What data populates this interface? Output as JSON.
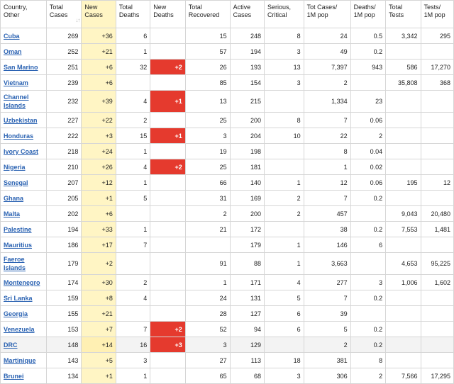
{
  "headers": [
    "Country, Other",
    "Total Cases",
    "New Cases",
    "Total Deaths",
    "New Deaths",
    "Total Recovered",
    "Active Cases",
    "Serious, Critical",
    "Tot Cases/ 1M pop",
    "Deaths/ 1M pop",
    "Total Tests",
    "Tests/ 1M pop"
  ],
  "sort_glyph": "↓↑",
  "rows": [
    {
      "country": "Cuba",
      "total_cases": "269",
      "new_cases": "+36",
      "total_deaths": "6",
      "new_deaths": "",
      "recovered": "15",
      "active": "248",
      "serious": "8",
      "cases_per_m": "24",
      "deaths_per_m": "0.5",
      "tests": "3,342",
      "tests_per_m": "295"
    },
    {
      "country": "Oman",
      "total_cases": "252",
      "new_cases": "+21",
      "total_deaths": "1",
      "new_deaths": "",
      "recovered": "57",
      "active": "194",
      "serious": "3",
      "cases_per_m": "49",
      "deaths_per_m": "0.2",
      "tests": "",
      "tests_per_m": ""
    },
    {
      "country": "San Marino",
      "total_cases": "251",
      "new_cases": "+6",
      "total_deaths": "32",
      "new_deaths": "+2",
      "recovered": "26",
      "active": "193",
      "serious": "13",
      "cases_per_m": "7,397",
      "deaths_per_m": "943",
      "tests": "586",
      "tests_per_m": "17,270"
    },
    {
      "country": "Vietnam",
      "total_cases": "239",
      "new_cases": "+6",
      "total_deaths": "",
      "new_deaths": "",
      "recovered": "85",
      "active": "154",
      "serious": "3",
      "cases_per_m": "2",
      "deaths_per_m": "",
      "tests": "35,808",
      "tests_per_m": "368"
    },
    {
      "country": "Channel Islands",
      "total_cases": "232",
      "new_cases": "+39",
      "total_deaths": "4",
      "new_deaths": "+1",
      "recovered": "13",
      "active": "215",
      "serious": "",
      "cases_per_m": "1,334",
      "deaths_per_m": "23",
      "tests": "",
      "tests_per_m": ""
    },
    {
      "country": "Uzbekistan",
      "total_cases": "227",
      "new_cases": "+22",
      "total_deaths": "2",
      "new_deaths": "",
      "recovered": "25",
      "active": "200",
      "serious": "8",
      "cases_per_m": "7",
      "deaths_per_m": "0.06",
      "tests": "",
      "tests_per_m": ""
    },
    {
      "country": "Honduras",
      "total_cases": "222",
      "new_cases": "+3",
      "total_deaths": "15",
      "new_deaths": "+1",
      "recovered": "3",
      "active": "204",
      "serious": "10",
      "cases_per_m": "22",
      "deaths_per_m": "2",
      "tests": "",
      "tests_per_m": ""
    },
    {
      "country": "Ivory Coast",
      "total_cases": "218",
      "new_cases": "+24",
      "total_deaths": "1",
      "new_deaths": "",
      "recovered": "19",
      "active": "198",
      "serious": "",
      "cases_per_m": "8",
      "deaths_per_m": "0.04",
      "tests": "",
      "tests_per_m": ""
    },
    {
      "country": "Nigeria",
      "total_cases": "210",
      "new_cases": "+26",
      "total_deaths": "4",
      "new_deaths": "+2",
      "recovered": "25",
      "active": "181",
      "serious": "",
      "cases_per_m": "1",
      "deaths_per_m": "0.02",
      "tests": "",
      "tests_per_m": ""
    },
    {
      "country": "Senegal",
      "total_cases": "207",
      "new_cases": "+12",
      "total_deaths": "1",
      "new_deaths": "",
      "recovered": "66",
      "active": "140",
      "serious": "1",
      "cases_per_m": "12",
      "deaths_per_m": "0.06",
      "tests": "195",
      "tests_per_m": "12"
    },
    {
      "country": "Ghana",
      "total_cases": "205",
      "new_cases": "+1",
      "total_deaths": "5",
      "new_deaths": "",
      "recovered": "31",
      "active": "169",
      "serious": "2",
      "cases_per_m": "7",
      "deaths_per_m": "0.2",
      "tests": "",
      "tests_per_m": ""
    },
    {
      "country": "Malta",
      "total_cases": "202",
      "new_cases": "+6",
      "total_deaths": "",
      "new_deaths": "",
      "recovered": "2",
      "active": "200",
      "serious": "2",
      "cases_per_m": "457",
      "deaths_per_m": "",
      "tests": "9,043",
      "tests_per_m": "20,480"
    },
    {
      "country": "Palestine",
      "total_cases": "194",
      "new_cases": "+33",
      "total_deaths": "1",
      "new_deaths": "",
      "recovered": "21",
      "active": "172",
      "serious": "",
      "cases_per_m": "38",
      "deaths_per_m": "0.2",
      "tests": "7,553",
      "tests_per_m": "1,481"
    },
    {
      "country": "Mauritius",
      "total_cases": "186",
      "new_cases": "+17",
      "total_deaths": "7",
      "new_deaths": "",
      "recovered": "",
      "active": "179",
      "serious": "1",
      "cases_per_m": "146",
      "deaths_per_m": "6",
      "tests": "",
      "tests_per_m": ""
    },
    {
      "country": "Faeroe Islands",
      "total_cases": "179",
      "new_cases": "+2",
      "total_deaths": "",
      "new_deaths": "",
      "recovered": "91",
      "active": "88",
      "serious": "1",
      "cases_per_m": "3,663",
      "deaths_per_m": "",
      "tests": "4,653",
      "tests_per_m": "95,225"
    },
    {
      "country": "Montenegro",
      "total_cases": "174",
      "new_cases": "+30",
      "total_deaths": "2",
      "new_deaths": "",
      "recovered": "1",
      "active": "171",
      "serious": "4",
      "cases_per_m": "277",
      "deaths_per_m": "3",
      "tests": "1,006",
      "tests_per_m": "1,602"
    },
    {
      "country": "Sri Lanka",
      "total_cases": "159",
      "new_cases": "+8",
      "total_deaths": "4",
      "new_deaths": "",
      "recovered": "24",
      "active": "131",
      "serious": "5",
      "cases_per_m": "7",
      "deaths_per_m": "0.2",
      "tests": "",
      "tests_per_m": ""
    },
    {
      "country": "Georgia",
      "total_cases": "155",
      "new_cases": "+21",
      "total_deaths": "",
      "new_deaths": "",
      "recovered": "28",
      "active": "127",
      "serious": "6",
      "cases_per_m": "39",
      "deaths_per_m": "",
      "tests": "",
      "tests_per_m": ""
    },
    {
      "country": "Venezuela",
      "total_cases": "153",
      "new_cases": "+7",
      "total_deaths": "7",
      "new_deaths": "+2",
      "recovered": "52",
      "active": "94",
      "serious": "6",
      "cases_per_m": "5",
      "deaths_per_m": "0.2",
      "tests": "",
      "tests_per_m": ""
    },
    {
      "country": "DRC",
      "total_cases": "148",
      "new_cases": "+14",
      "total_deaths": "16",
      "new_deaths": "+3",
      "recovered": "3",
      "active": "129",
      "serious": "",
      "cases_per_m": "2",
      "deaths_per_m": "0.2",
      "tests": "",
      "tests_per_m": ""
    },
    {
      "country": "Martinique",
      "total_cases": "143",
      "new_cases": "+5",
      "total_deaths": "3",
      "new_deaths": "",
      "recovered": "27",
      "active": "113",
      "serious": "18",
      "cases_per_m": "381",
      "deaths_per_m": "8",
      "tests": "",
      "tests_per_m": ""
    },
    {
      "country": "Brunei",
      "total_cases": "134",
      "new_cases": "+1",
      "total_deaths": "1",
      "new_deaths": "",
      "recovered": "65",
      "active": "68",
      "serious": "3",
      "cases_per_m": "306",
      "deaths_per_m": "2",
      "tests": "7,566",
      "tests_per_m": "17,295"
    }
  ]
}
